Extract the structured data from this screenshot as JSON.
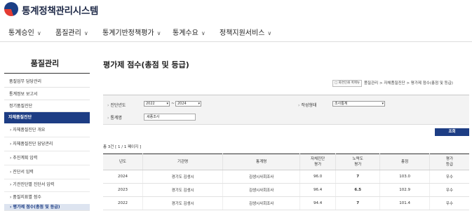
{
  "header": {
    "logo_text": "통계정책관리시스템"
  },
  "gnb": {
    "items": [
      {
        "label": "통계승인"
      },
      {
        "label": "품질관리"
      },
      {
        "label": "통계기반정책평가"
      },
      {
        "label": "통계수요"
      },
      {
        "label": "정책지원서비스"
      }
    ]
  },
  "sidebar": {
    "title": "품질관리",
    "items": [
      {
        "label": "품질업무 담당관리"
      },
      {
        "label": "통계정보 보고서"
      },
      {
        "label": "정기품질진단"
      }
    ],
    "active_section": "자체품질진단",
    "subitems": [
      {
        "label": "› 자체품질진단 개요"
      },
      {
        "label": "› 자체품질진단 담당관리"
      },
      {
        "label": "› 추진계획 입력"
      },
      {
        "label": "› 진단서 입력"
      },
      {
        "label": "› 기관진단별 진단서 입력"
      },
      {
        "label": "› 품질지표별 점수"
      },
      {
        "label": "› 평가제 점수(총점 및 등급)"
      }
    ]
  },
  "main": {
    "title": "평가제 점수(총점 및 등급)",
    "util_button": "□ 화면인쇄 퀵메뉴",
    "breadcrumb": "품질관리 > 자체품질진단 > 평가제 점수(총점 및 등급)",
    "search": {
      "year_label": "진단년도",
      "year_from": "2022",
      "tilde": "~",
      "year_to": "2024",
      "form_label": "작성형태",
      "form_value": "조사통계",
      "stat_label": "통계명",
      "stat_value": "세종조사",
      "button": "조회"
    },
    "total": "총 3건 [ 1 / 1 페이지 ]",
    "table": {
      "columns": [
        "년도",
        "기관명",
        "통계명",
        "자체진단\n평가",
        "노력도\n평가",
        "총점",
        "평가\n등급"
      ],
      "rows": [
        [
          "2024",
          "경기도 김생시",
          "김생시사회조사",
          "96.0",
          "7",
          "103.0",
          "우수"
        ],
        [
          "2023",
          "경기도 김생시",
          "김생시사회조사",
          "96.4",
          "6.5",
          "102.9",
          "우수"
        ],
        [
          "2022",
          "경기도 김생시",
          "김생시사회조사",
          "94.4",
          "7",
          "101.4",
          "우수"
        ]
      ]
    }
  }
}
